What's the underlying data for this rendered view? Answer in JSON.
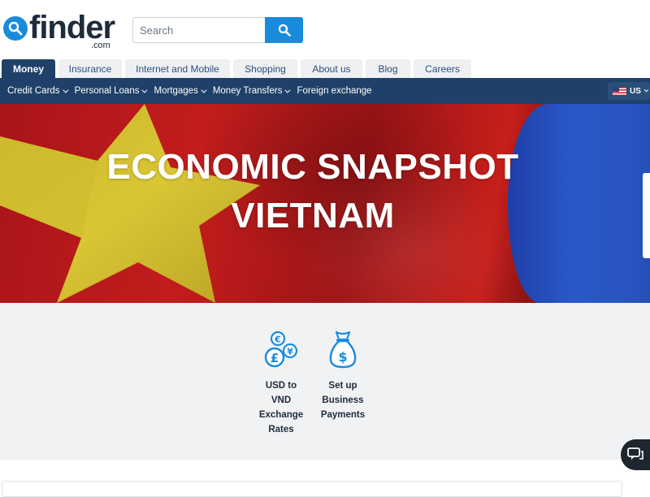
{
  "header": {
    "logo_text": "finder",
    "logo_sub": ".com",
    "search_placeholder": "Search"
  },
  "tabs": [
    {
      "label": "Money",
      "active": true
    },
    {
      "label": "Insurance",
      "active": false
    },
    {
      "label": "Internet and Mobile",
      "active": false
    },
    {
      "label": "Shopping",
      "active": false
    },
    {
      "label": "About us",
      "active": false
    },
    {
      "label": "Blog",
      "active": false
    },
    {
      "label": "Careers",
      "active": false
    }
  ],
  "subnav": {
    "items": [
      {
        "label": "Credit Cards",
        "dropdown": true
      },
      {
        "label": "Personal Loans",
        "dropdown": true
      },
      {
        "label": "Mortgages",
        "dropdown": true
      },
      {
        "label": "Money Transfers",
        "dropdown": true
      },
      {
        "label": "Foreign exchange",
        "dropdown": false
      }
    ],
    "locale": "US"
  },
  "hero": {
    "title_line1": "ECONOMIC SNAPSHOT",
    "title_line2": "VIETNAM"
  },
  "quick_links": [
    {
      "label": "USD to VND Exchange Rates",
      "icon": "currency-coins-icon"
    },
    {
      "label": "Set up Business Payments",
      "icon": "money-bag-icon"
    }
  ],
  "colors": {
    "brand_blue": "#1a8bdc",
    "nav_navy": "#1f4068",
    "flag_red": "#c21d1c",
    "star_yellow": "#d6c12a",
    "flag_blue": "#2b58c8",
    "panel_bg": "#f1f2f4"
  }
}
